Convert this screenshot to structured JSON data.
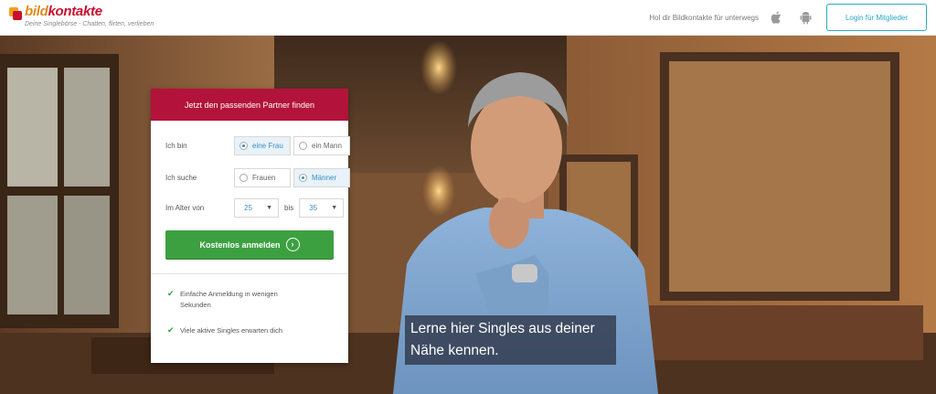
{
  "header": {
    "logo_word_part1": "bild",
    "logo_word_part2": "kontakte",
    "logo_tagline": "Deine Singlebörse - Chatten, flirten, verlieben",
    "app_text": "Hol dir Bildkontakte für unterwegs",
    "apple_icon": "apple-icon",
    "android_icon": "android-icon",
    "login_label": "Login für Mitglieder"
  },
  "form": {
    "title": "Jetzt den passenden Partner finden",
    "i_am_label": "Ich bin",
    "i_am_options": [
      "eine Frau",
      "ein Mann"
    ],
    "i_am_selected": "eine Frau",
    "seeking_label": "Ich suche",
    "seeking_options": [
      "Frauen",
      "Männer"
    ],
    "seeking_selected": "Männer",
    "age_label": "Im Alter von",
    "age_from": "25",
    "age_to_label": "bis",
    "age_to": "35",
    "submit_label": "Kostenlos anmelden"
  },
  "features": [
    "Einfache Anmeldung in wenigen Sekunden",
    "Viele aktive Singles erwarten dich"
  ],
  "hero": {
    "caption_line1": "Lerne hier Singles aus deiner",
    "caption_line2": "Nähe kennen."
  },
  "colors": {
    "brand_red": "#b3133a",
    "brand_orange": "#e08a1e",
    "accent_teal": "#2aa8c6",
    "cta_green": "#3ca040"
  }
}
